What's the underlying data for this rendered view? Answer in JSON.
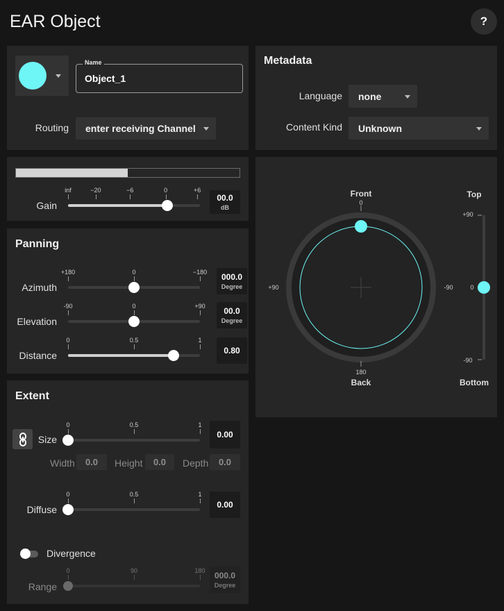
{
  "header": {
    "title": "EAR Object",
    "help_label": "?"
  },
  "object": {
    "color": "#6ef5f5",
    "name_label": "Name",
    "name_value": "Object_1",
    "routing_label": "Routing",
    "routing_value": "enter receiving Channel"
  },
  "metadata": {
    "title": "Metadata",
    "language_label": "Language",
    "language_value": "none",
    "content_kind_label": "Content Kind",
    "content_kind_value": "Unknown"
  },
  "gain": {
    "label": "Gain",
    "meter_level": 0.5,
    "ticks": [
      "inf",
      "−20",
      "−6",
      "0",
      "+6"
    ],
    "value": "00.0",
    "unit": "dB",
    "slider_fraction": 0.755
  },
  "panning": {
    "title": "Panning",
    "azimuth": {
      "label": "Azimuth",
      "ticks": [
        "+180",
        "0",
        "−180"
      ],
      "value": "000.0",
      "unit": "Degree",
      "fraction": 0.5
    },
    "elevation": {
      "label": "Elevation",
      "ticks": [
        "-90",
        "0",
        "+90"
      ],
      "value": "00.0",
      "unit": "Degree",
      "fraction": 0.5
    },
    "distance": {
      "label": "Distance",
      "ticks": [
        "0",
        "0.5",
        "1"
      ],
      "value": "0.80",
      "fraction": 0.8
    }
  },
  "extent": {
    "title": "Extent",
    "size": {
      "label": "Size",
      "ticks": [
        "0",
        "0.5",
        "1"
      ],
      "value": "0.00",
      "fraction": 0
    },
    "width_label": "Width",
    "width_value": "0.0",
    "height_label": "Height",
    "height_value": "0.0",
    "depth_label": "Depth",
    "depth_value": "0.0",
    "diffuse": {
      "label": "Diffuse",
      "ticks": [
        "0",
        "0.5",
        "1"
      ],
      "value": "0.00",
      "fraction": 0
    },
    "divergence_label": "Divergence",
    "range": {
      "label": "Range",
      "ticks": [
        "0",
        "90",
        "180"
      ],
      "value": "000.0",
      "unit": "Degree",
      "fraction": 0
    }
  },
  "panner": {
    "front_label": "Front",
    "front_value": "0",
    "back_label": "Back",
    "back_value": "180",
    "left_value": "+90",
    "right_value": "-90",
    "top_label": "Top",
    "bottom_label": "Bottom",
    "elev_top": "+90",
    "elev_mid": "0",
    "elev_bottom": "-90",
    "accent": "#6ef5f5"
  }
}
